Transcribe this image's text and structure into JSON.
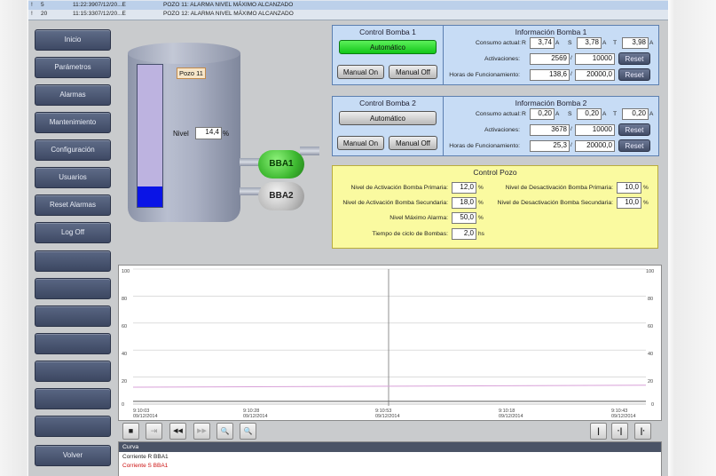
{
  "alarms": [
    {
      "num": "5",
      "text": "11:22:3907/12/20...E",
      "message": "POZO 11: ALARMA NIVEL MÁXIMO ALCANZADO"
    },
    {
      "num": "20",
      "text": "11:15:3307/12/20...E",
      "message": "POZO 12: ALARMA NIVEL MÁXIMO ALCANZADO"
    }
  ],
  "nav": {
    "items": [
      "Inicio",
      "Parámetros",
      "Alarmas",
      "Mantenimiento",
      "Configuración",
      "Usuarios",
      "Reset Alarmas",
      "Log Off"
    ],
    "back": "Volver"
  },
  "tank": {
    "tag": "Pozo 11",
    "level_label": "Nivel",
    "level_value": "14,4",
    "level_unit": "%",
    "level_fraction": 0.144
  },
  "pumps": {
    "pump1": "BBA1",
    "pump2": "BBA2"
  },
  "control1": {
    "title": "Control Bomba 1",
    "mode": "Automático",
    "manual_on": "Manual On",
    "manual_off": "Manual Off"
  },
  "control2": {
    "title": "Control Bomba 2",
    "mode": "Automático",
    "manual_on": "Manual On",
    "manual_off": "Manual Off"
  },
  "info1": {
    "title": "Información Bomba 1",
    "consumo_label": "Consumo actual:",
    "r_label": "R",
    "s_label": "S",
    "t_label": "T",
    "r": "3,74",
    "s": "3,78",
    "t": "3,98",
    "unit_a": "A",
    "activaciones_label": "Activaciones:",
    "activaciones": "2569",
    "activaciones_max": "10000",
    "horas_label": "Horas de Funcionamiento:",
    "horas": "138,6",
    "horas_max": "20000,0",
    "reset": "Reset"
  },
  "info2": {
    "title": "Información Bomba 2",
    "consumo_label": "Consumo actual:",
    "r_label": "R",
    "s_label": "S",
    "t_label": "T",
    "r": "0,20",
    "s": "0,20",
    "t": "0,20",
    "unit_a": "A",
    "activaciones_label": "Activaciones:",
    "activaciones": "3678",
    "activaciones_max": "10000",
    "horas_label": "Horas de Funcionamiento:",
    "horas": "25,3",
    "horas_max": "20000,0",
    "reset": "Reset"
  },
  "pozo": {
    "title": "Control Pozo",
    "rows": [
      {
        "label": "Nivel de Activación Bomba Primaria:",
        "value": "12,0",
        "unit": "%"
      },
      {
        "label": "Nivel de Activación Bomba Secundaria:",
        "value": "18,0",
        "unit": "%"
      },
      {
        "label": "Nivel Máximo Alarma:",
        "value": "50,0",
        "unit": "%"
      },
      {
        "label": "Tiempo de ciclo de Bombas:",
        "value": "2,0",
        "unit": "hs"
      }
    ],
    "right_rows": [
      {
        "label": "Nivel de Desactivación Bomba Primaria:",
        "value": "10,0",
        "unit": "%"
      },
      {
        "label": "Nivel de Desactivación Bomba Secundaria:",
        "value": "10,0",
        "unit": "%"
      }
    ]
  },
  "chart": {
    "y_ticks": [
      "100",
      "80",
      "60",
      "40",
      "20",
      "0"
    ],
    "x_labels": [
      {
        "time": "9:10:03",
        "date": "09/12/2014"
      },
      {
        "time": "9:10:28",
        "date": "09/12/2014"
      },
      {
        "time": "9:10:53",
        "date": "09/12/2014"
      },
      {
        "time": "9:10:18",
        "date": "09/12/2014"
      },
      {
        "time": "9:10:43",
        "date": "09/12/2014"
      }
    ],
    "series_colors": {
      "r": "#d8a0d8",
      "s": "#6a6a6a"
    }
  },
  "chart_toolbar": [
    "■",
    "⇥",
    "◀◀",
    "▶▶",
    "🔍",
    "🔍"
  ],
  "curve": {
    "header": "Curva",
    "rows": [
      {
        "text": "Corriente R BBA1",
        "color": "#222222"
      },
      {
        "text": "Corriente S BBA1",
        "color": "#cc1111"
      }
    ]
  }
}
